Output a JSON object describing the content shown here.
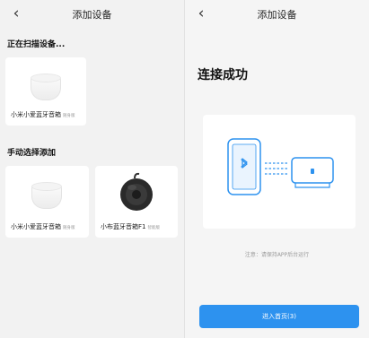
{
  "left_screen": {
    "nav": {
      "back_icon": "chevron-left-icon",
      "title": "添加设备"
    },
    "scanning_section": {
      "label": "正在扫描设备...",
      "devices": [
        {
          "name": "小米小爱蓝牙音箱",
          "badge": "随身版",
          "image": "white-speaker"
        }
      ]
    },
    "manual_section": {
      "label": "手动选择添加",
      "devices": [
        {
          "name": "小米小爱蓝牙音箱",
          "badge": "随身版",
          "image": "white-speaker"
        },
        {
          "name": "小布蓝牙音箱F1",
          "badge": "智能版",
          "image": "black-round-speaker"
        }
      ]
    }
  },
  "right_screen": {
    "nav": {
      "back_icon": "chevron-left-icon",
      "title": "添加设备"
    },
    "heading": "连接成功",
    "illustration": {
      "icons": [
        "phone-icon",
        "bluetooth-icon",
        "speaker-icon"
      ],
      "accent_color": "#2d92ef"
    },
    "notice": "注意：请保持APP后台运行",
    "primary_button": {
      "label": "进入首页(3)"
    }
  },
  "colors": {
    "background": "#f2f2f2",
    "card": "#ffffff",
    "accent": "#2d92ef"
  }
}
